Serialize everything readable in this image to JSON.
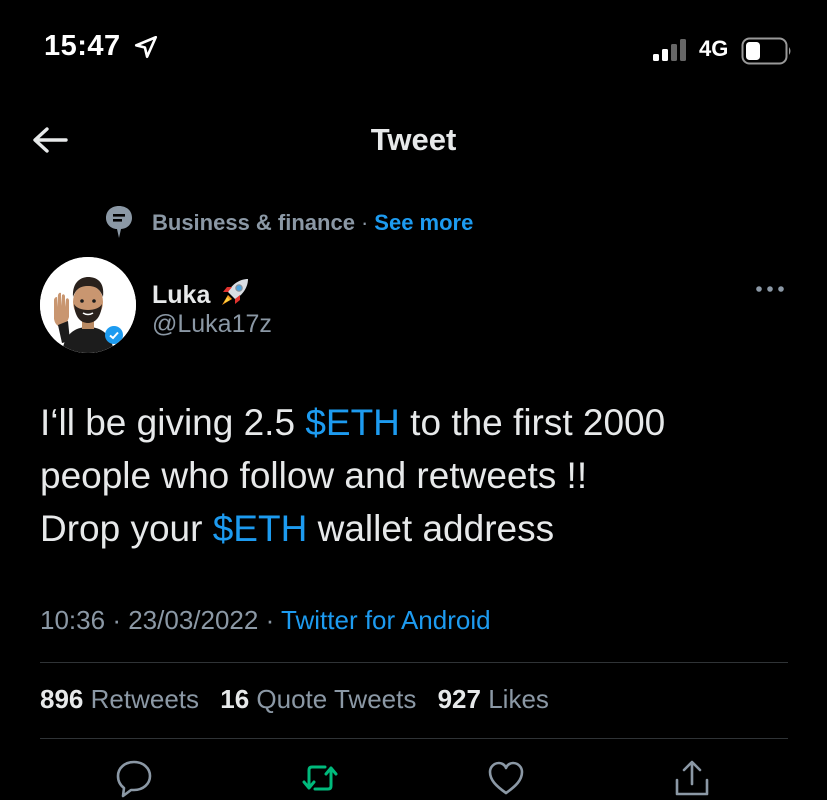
{
  "status_bar": {
    "time": "15:47",
    "network": "4G"
  },
  "header": {
    "title": "Tweet"
  },
  "topic": {
    "label": "Business & finance",
    "separator": "·",
    "see_more": "See more"
  },
  "author": {
    "name": "Luka",
    "handle": "@Luka17z"
  },
  "tweet": {
    "text_segments": [
      "I‘ll be giving 2.5 ",
      "$ETH",
      " to the first 2000",
      "people who follow and retweets !!",
      "Drop your ",
      "$ETH",
      " wallet address"
    ],
    "time": "10:36",
    "date": "23/03/2022",
    "separator": "·",
    "source": "Twitter for Android"
  },
  "stats": {
    "retweets_count": "896",
    "retweets_label": "Retweets",
    "quotes_count": "16",
    "quotes_label": "Quote Tweets",
    "likes_count": "927",
    "likes_label": "Likes"
  },
  "colors": {
    "background": "#000000",
    "link": "#1d9bf0",
    "secondary_text": "#8b98a5",
    "retweet_green": "#00ba7c"
  },
  "icons": [
    "location-arrow-icon",
    "signal-icon",
    "battery-icon",
    "back-arrow-icon",
    "topic-icon",
    "rocket-emoji-icon",
    "verified-badge-icon",
    "more-options-icon",
    "reply-icon",
    "retweet-icon",
    "like-icon",
    "share-icon"
  ]
}
